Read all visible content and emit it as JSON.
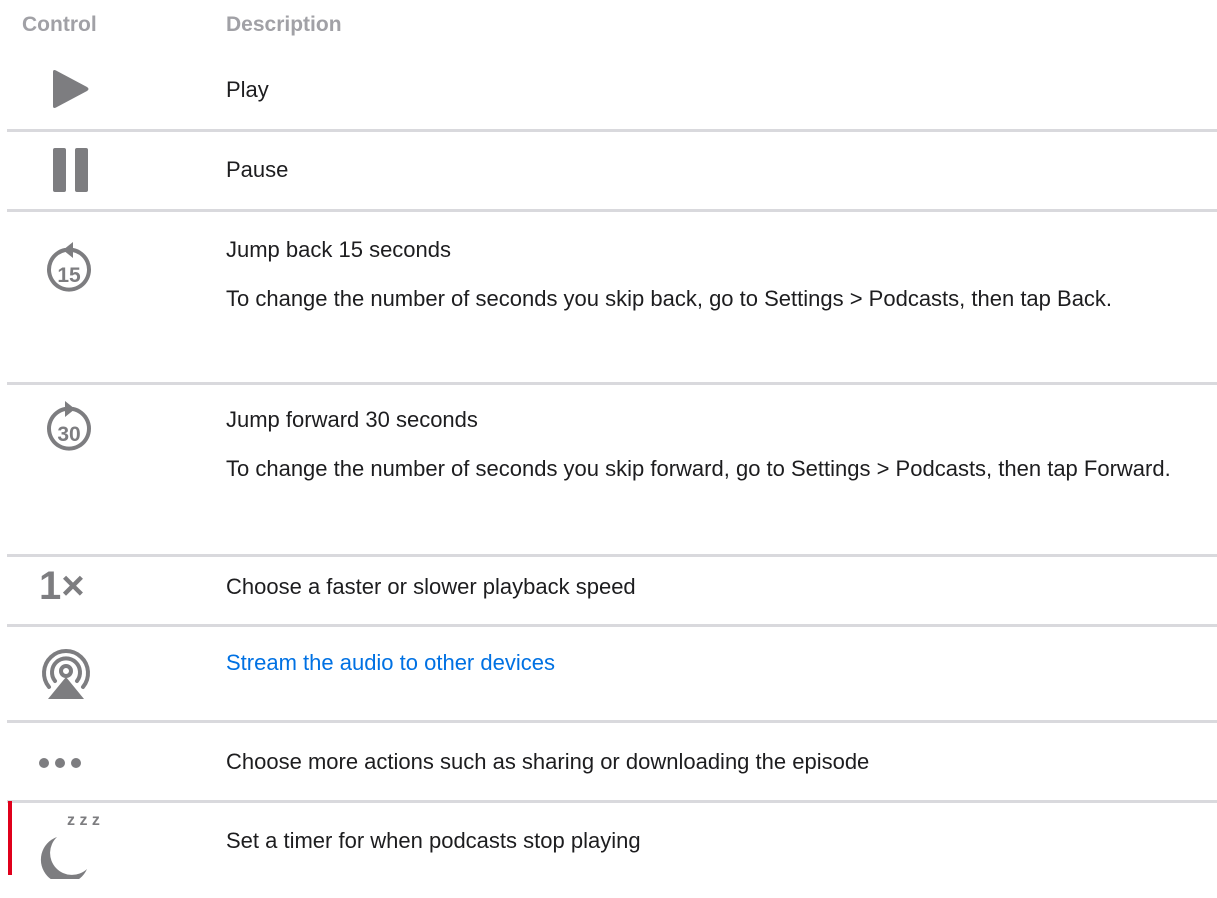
{
  "header": {
    "control": "Control",
    "description": "Description"
  },
  "rows": [
    {
      "icon": "play-icon",
      "lines": [
        "Play"
      ]
    },
    {
      "icon": "pause-icon",
      "lines": [
        "Pause"
      ]
    },
    {
      "icon": "jump-back-15-icon",
      "icon_text": "15",
      "lines": [
        "Jump back 15 seconds",
        "To change the number of seconds you skip back, go to Settings > Podcasts, then tap Back."
      ]
    },
    {
      "icon": "jump-forward-30-icon",
      "icon_text": "30",
      "lines": [
        "Jump forward 30 seconds",
        "To change the number of seconds you skip forward, go to Settings > Podcasts, then tap Forward."
      ]
    },
    {
      "icon": "playback-speed-icon",
      "icon_text": "1×",
      "lines": [
        "Choose a faster or slower playback speed"
      ]
    },
    {
      "icon": "airplay-audio-icon",
      "lines": [
        "Stream the audio to other devices"
      ],
      "link": true
    },
    {
      "icon": "more-actions-icon",
      "lines": [
        "Choose more actions such as sharing or downloading the episode"
      ]
    },
    {
      "icon": "sleep-timer-icon",
      "icon_text": "z z z",
      "lines": [
        "Set a timer for when podcasts stop playing"
      ]
    }
  ],
  "colors": {
    "icon_gray": "#7d7d80",
    "header_gray": "#a1a1a6",
    "link_blue": "#0071e3",
    "divider": "#d9d9dd",
    "accent_red": "#e0001b"
  }
}
